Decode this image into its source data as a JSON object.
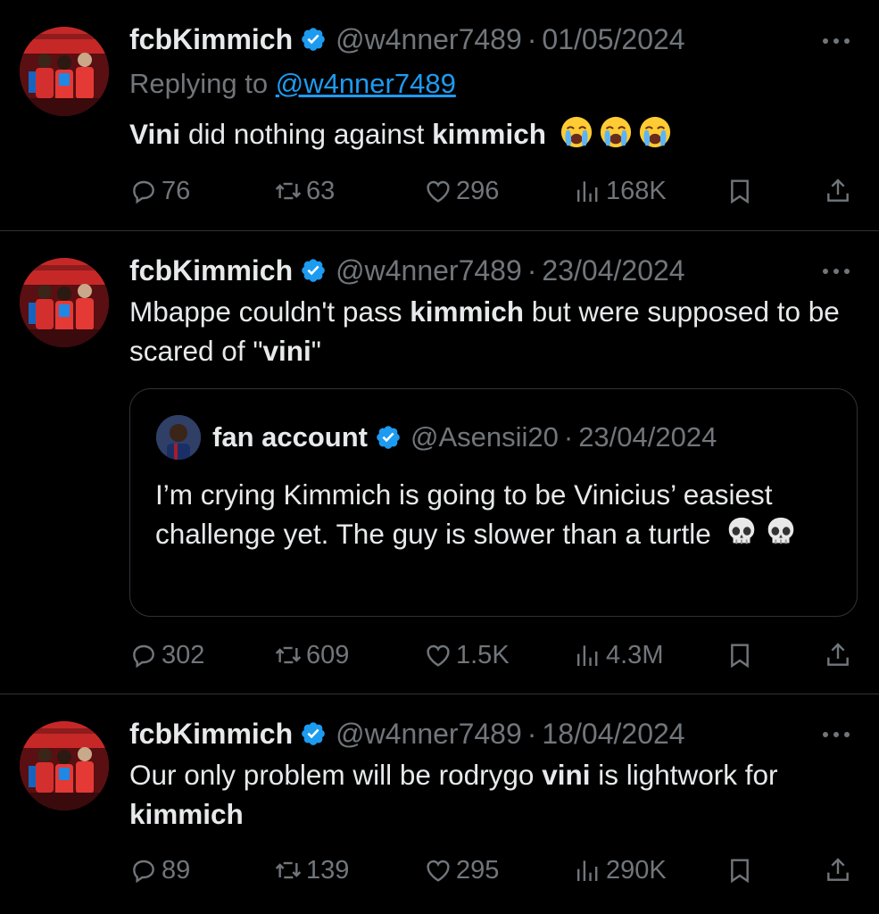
{
  "tweets": [
    {
      "name": "fcbKimmich",
      "handle": "@w4nner7489",
      "date": "01/05/2024",
      "replying_prefix": "Replying to",
      "replying_to": "@w4nner7489",
      "text_parts": [
        "Vini",
        " did nothing against ",
        "kimmich"
      ],
      "emojis": [
        "loudly-crying-face",
        "loudly-crying-face",
        "loudly-crying-face"
      ],
      "replies": "76",
      "retweets": "63",
      "likes": "296",
      "views": "168K"
    },
    {
      "name": "fcbKimmich",
      "handle": "@w4nner7489",
      "date": "23/04/2024",
      "text_parts": [
        "Mbappe couldn't pass ",
        "kimmich",
        " but were supposed to be scared of \"",
        "vini",
        "\""
      ],
      "quote": {
        "name": "fan account",
        "handle": "@Asensii20",
        "date": "23/04/2024",
        "text": "I’m crying Kimmich is going to be Vinicius’ easiest challenge yet. The guy is slower than a turtle",
        "emojis": [
          "skull",
          "skull"
        ]
      },
      "replies": "302",
      "retweets": "609",
      "likes": "1.5K",
      "views": "4.3M"
    },
    {
      "name": "fcbKimmich",
      "handle": "@w4nner7489",
      "date": "18/04/2024",
      "text_parts": [
        "Our only problem will be rodrygo ",
        "vini",
        " is lightwork for ",
        "kimmich"
      ],
      "replies": "89",
      "retweets": "139",
      "likes": "295",
      "views": "290K"
    }
  ],
  "separator": "·",
  "colors": {
    "background": "#000000",
    "text": "#e7e9ea",
    "muted": "#71767b",
    "accent": "#1d9bf0",
    "divider": "#2f3336"
  }
}
